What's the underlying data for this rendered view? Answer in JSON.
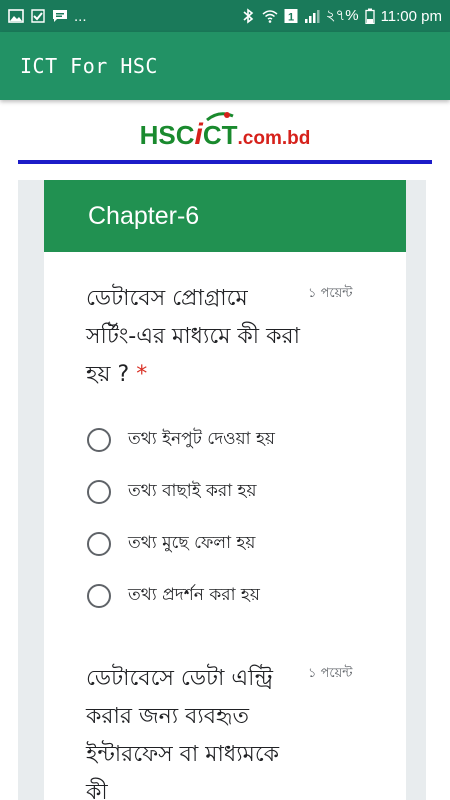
{
  "status_bar": {
    "battery": "২৭%",
    "time": "11:00 pm",
    "dots": "...",
    "sim": "1",
    "icons": [
      "image-icon",
      "check-flag-icon",
      "message-icon",
      "bluetooth-icon",
      "wifi-icon",
      "sim-icon",
      "signal-icon",
      "battery-icon"
    ]
  },
  "app_bar": {
    "title": "ICT For HSC"
  },
  "banner": {
    "logo_hsc": "HSC",
    "logo_i": "i",
    "logo_ct": "CT",
    "logo_domain": ".com.bd"
  },
  "form": {
    "chapter_title": "Chapter-6",
    "questions": [
      {
        "text": "ডেটাবেস প্রোগ্রামে সর্টিং-এর মাধ্যমে কী করা হয় ?",
        "required": "*",
        "points": "১ পয়েন্ট",
        "options": [
          "তথ্য ইনপুট দেওয়া হয়",
          "তথ্য বাছাই করা হয়",
          "তথ্য মুছে ফেলা হয়",
          "তথ্য প্রদর্শন করা হয়"
        ]
      },
      {
        "text": "ডেটাবেসে ডেটা এন্ট্রি করার জন্য ব্যবহৃত ইন্টারফেস বা মাধ্যমকে কী",
        "points": "১ পয়েন্ট"
      }
    ]
  },
  "colors": {
    "status_bar": "#1a7a5a",
    "app_bar": "#229265",
    "card_header": "#219151",
    "banner_line": "#1c1cc8",
    "logo_green": "#1a8a2e",
    "logo_red": "#d6211b",
    "required_red": "#d93025"
  }
}
